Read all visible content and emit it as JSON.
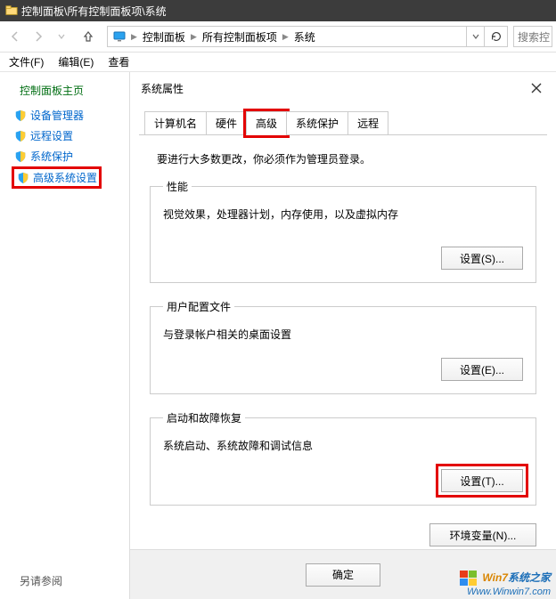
{
  "addr_strip": "控制面板\\所有控制面板项\\系统",
  "breadcrumb": {
    "seg1": "控制面板",
    "seg2": "所有控制面板项",
    "seg3": "系统"
  },
  "search": {
    "placeholder": "搜索控"
  },
  "menubar": {
    "file": "文件(F)",
    "edit": "编辑(E)",
    "view": "查看"
  },
  "sidebar": {
    "title": "控制面板主页",
    "items": [
      "设备管理器",
      "远程设置",
      "系统保护",
      "高级系统设置"
    ],
    "see_also": "另请参阅"
  },
  "dialog": {
    "title": "系统属性",
    "tabs": [
      "计算机名",
      "硬件",
      "高级",
      "系统保护",
      "远程"
    ],
    "active_tab_index": 2,
    "admin_note": "要进行大多数更改，你必须作为管理员登录。",
    "groups": {
      "perf": {
        "legend": "性能",
        "desc": "视觉效果，处理器计划，内存使用，以及虚拟内存",
        "btn": "设置(S)..."
      },
      "profiles": {
        "legend": "用户配置文件",
        "desc": "与登录帐户相关的桌面设置",
        "btn": "设置(E)..."
      },
      "startup": {
        "legend": "启动和故障恢复",
        "desc": "系统启动、系统故障和调试信息",
        "btn": "设置(T)..."
      }
    },
    "env_btn": "环境变量(N)...",
    "ok": "确定"
  },
  "watermark": {
    "brand_a": "Win7",
    "brand_b": "系统之家",
    "url": "Www.Winwin7.com"
  }
}
